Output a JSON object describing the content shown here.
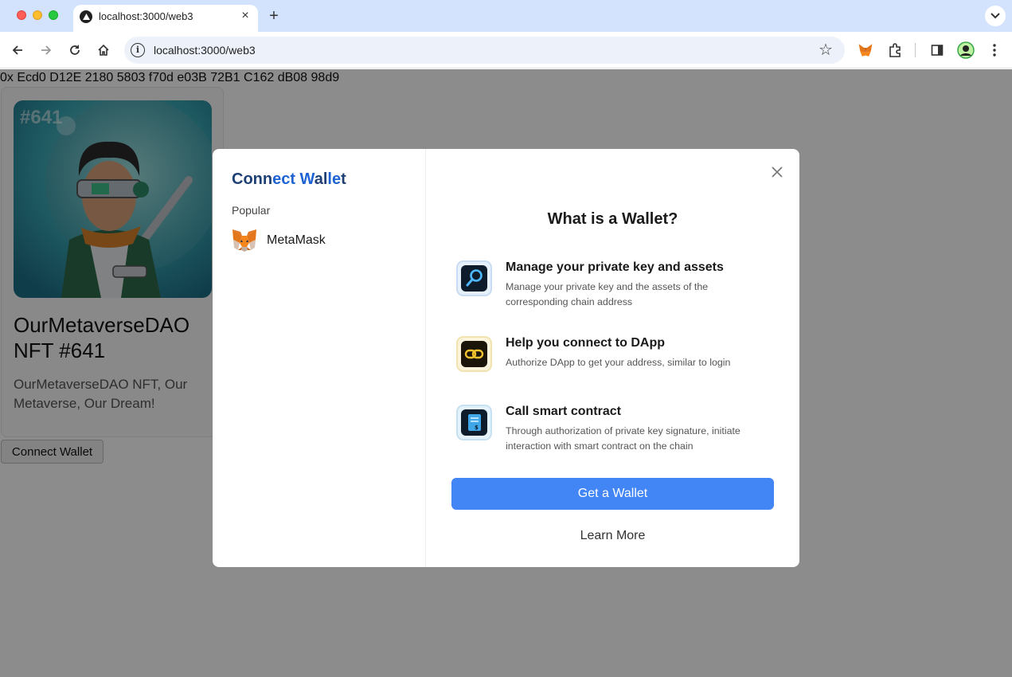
{
  "browser": {
    "tab_title": "localhost:3000/web3",
    "url": "localhost:3000/web3",
    "new_tab_label": "+",
    "tab_close_label": "×"
  },
  "page": {
    "address": "0x Ecd0 D12E 2180 5803 f70d e03B 72B1 C162 dB08 98d9",
    "nft": {
      "id_tag": "#641",
      "name": "OurMetaverseDAO NFT #641",
      "description": "OurMetaverseDAO NFT, Our Metaverse, Our Dream!"
    },
    "connect_button": "Connect Wallet"
  },
  "modal": {
    "title_part1": "Conn",
    "title_part2": "ect W",
    "title_part3": "al",
    "title_part4": "le",
    "title_part5": "t",
    "section_label": "Popular",
    "wallets": [
      {
        "name": "MetaMask",
        "icon": "metamask-fox-icon"
      }
    ],
    "heading": "What is a Wallet?",
    "features": [
      {
        "title": "Manage your private key and assets",
        "description": "Manage your private key and the assets of the corresponding chain address",
        "icon": "key-search-icon"
      },
      {
        "title": "Help you connect to DApp",
        "description": "Authorize DApp to get your address, similar to login",
        "icon": "link-icon"
      },
      {
        "title": "Call smart contract",
        "description": "Through authorization of private key signature, initiate interaction with smart contract on the chain",
        "icon": "contract-icon"
      }
    ],
    "primary_button": "Get a Wallet",
    "secondary_link": "Learn More"
  },
  "colors": {
    "tabbar": "#d3e3fd",
    "primary_button": "#4285f4",
    "title_dark": "#1d3f74",
    "title_blue": "#1e63d4",
    "overlay": "rgba(0,0,0,0.45)"
  }
}
